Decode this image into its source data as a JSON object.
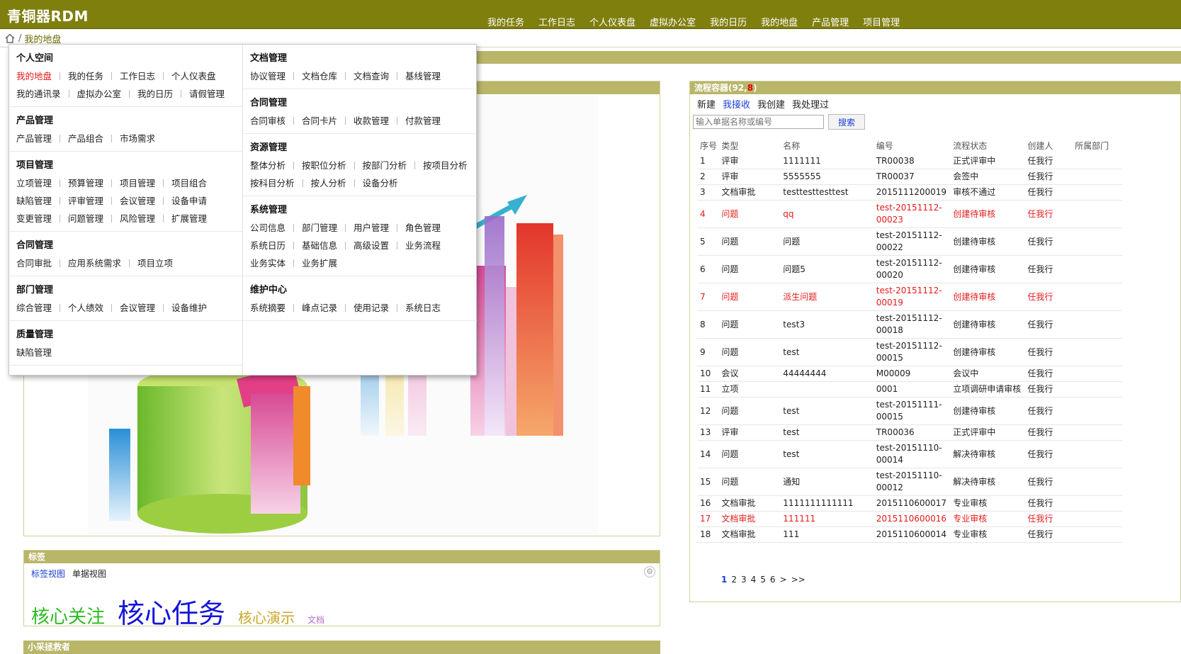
{
  "app": {
    "title": "青铜器RDM"
  },
  "topnav": [
    "我的任务",
    "工作日志",
    "个人仪表盘",
    "虚拟办公室",
    "我的日历",
    "我的地盘",
    "产品管理",
    "项目管理"
  ],
  "breadcrumb": {
    "sep": "/",
    "current": "我的地盘"
  },
  "menu": {
    "left": [
      {
        "title": "个人空间",
        "rows": [
          [
            "我的地盘",
            "我的任务",
            "工作日志",
            "个人仪表盘"
          ],
          [
            "我的通讯录",
            "虚拟办公室",
            "我的日历",
            "请假管理"
          ]
        ],
        "active": "我的地盘"
      },
      {
        "title": "产品管理",
        "rows": [
          [
            "产品管理",
            "产品组合",
            "市场需求"
          ]
        ]
      },
      {
        "title": "项目管理",
        "rows": [
          [
            "立项管理",
            "预算管理",
            "项目管理",
            "项目组合"
          ],
          [
            "缺陷管理",
            "评审管理",
            "会议管理",
            "设备申请"
          ],
          [
            "变更管理",
            "问题管理",
            "风险管理",
            "扩展管理"
          ]
        ]
      },
      {
        "title": "合同管理",
        "rows": [
          [
            "合同审批",
            "应用系统需求",
            "项目立项"
          ]
        ]
      },
      {
        "title": "部门管理",
        "rows": [
          [
            "综合管理",
            "个人绩效",
            "会议管理",
            "设备维护"
          ]
        ]
      },
      {
        "title": "质量管理",
        "rows": [
          [
            "缺陷管理"
          ]
        ]
      }
    ],
    "right": [
      {
        "title": "文档管理",
        "rows": [
          [
            "协议管理",
            "文档仓库",
            "文档查询",
            "基线管理"
          ]
        ]
      },
      {
        "title": "合同管理",
        "rows": [
          [
            "合同审核",
            "合同卡片",
            "收款管理",
            "付款管理"
          ]
        ]
      },
      {
        "title": "资源管理",
        "rows": [
          [
            "整体分析",
            "按职位分析",
            "按部门分析",
            "按项目分析"
          ],
          [
            "按科目分析",
            "按人分析",
            "设备分析"
          ]
        ]
      },
      {
        "title": "系统管理",
        "rows": [
          [
            "公司信息",
            "部门管理",
            "用户管理",
            "角色管理"
          ],
          [
            "系统日历",
            "基础信息",
            "高级设置",
            "业务流程"
          ],
          [
            "业务实体",
            "业务扩展"
          ]
        ]
      },
      {
        "title": "维护中心",
        "rows": [
          [
            "系统摘要",
            "峰点记录",
            "使用记录",
            "系统日志"
          ]
        ]
      }
    ]
  },
  "tags": {
    "header": "标签",
    "tabs": [
      "标签视图",
      "单据视图"
    ],
    "cloud": [
      {
        "text": "核心关注",
        "color": "#2dbb22",
        "size": "26px"
      },
      {
        "text": "核心任务",
        "color": "#1515d8",
        "size": "38px"
      },
      {
        "text": "核心演示",
        "color": "#c9a62a",
        "size": "20px"
      },
      {
        "text": "文档",
        "color": "#b36cc6",
        "size": "12px"
      }
    ]
  },
  "bottom": {
    "header": "小采拯救者"
  },
  "flow": {
    "title": "流程容器",
    "count_a": "92",
    "count_b": "8",
    "tabs": [
      "新建",
      "我接收",
      "我创建",
      "我处理过"
    ],
    "search_placeholder": "输入单据名称或编号",
    "search_button": "搜索",
    "columns": [
      "序号",
      "类型",
      "名称",
      "编号",
      "流程状态",
      "创建人",
      "所属部门"
    ],
    "rows": [
      {
        "no": "1",
        "type": "评审",
        "name": "1111111",
        "code": "TR00038",
        "status": "正式评审中",
        "creator": "任我行",
        "red": false
      },
      {
        "no": "2",
        "type": "评审",
        "name": "5555555",
        "code": "TR00037",
        "status": "会签中",
        "creator": "任我行",
        "red": false
      },
      {
        "no": "3",
        "type": "文档审批",
        "name": "testtesttesttest",
        "code": "2015111200019",
        "status": "审核不通过",
        "creator": "任我行",
        "red": false
      },
      {
        "no": "4",
        "type": "问题",
        "name": "qq",
        "code": "test-20151112-00023",
        "status": "创建待审核",
        "creator": "任我行",
        "red": true
      },
      {
        "no": "5",
        "type": "问题",
        "name": "问题",
        "code": "test-20151112-00022",
        "status": "创建待审核",
        "creator": "任我行",
        "red": false
      },
      {
        "no": "6",
        "type": "问题",
        "name": "问题5",
        "code": "test-20151112-00020",
        "status": "创建待审核",
        "creator": "任我行",
        "red": false
      },
      {
        "no": "7",
        "type": "问题",
        "name": "派生问题",
        "code": "test-20151112-00019",
        "status": "创建待审核",
        "creator": "任我行",
        "red": true
      },
      {
        "no": "8",
        "type": "问题",
        "name": "test3",
        "code": "test-20151112-00018",
        "status": "创建待审核",
        "creator": "任我行",
        "red": false
      },
      {
        "no": "9",
        "type": "问题",
        "name": "test",
        "code": "test-20151112-00015",
        "status": "创建待审核",
        "creator": "任我行",
        "red": false
      },
      {
        "no": "10",
        "type": "会议",
        "name": "44444444",
        "code": "M00009",
        "status": "会议中",
        "creator": "任我行",
        "red": false
      },
      {
        "no": "11",
        "type": "立项",
        "name": "",
        "code": "0001",
        "status": "立项调研申请审核",
        "creator": "任我行",
        "red": false
      },
      {
        "no": "12",
        "type": "问题",
        "name": "test",
        "code": "test-20151111-00015",
        "status": "创建待审核",
        "creator": "任我行",
        "red": false
      },
      {
        "no": "13",
        "type": "评审",
        "name": "test",
        "code": "TR00036",
        "status": "正式评审中",
        "creator": "任我行",
        "red": false
      },
      {
        "no": "14",
        "type": "问题",
        "name": "test",
        "code": "test-20151110-00014",
        "status": "解决待审核",
        "creator": "任我行",
        "red": false
      },
      {
        "no": "15",
        "type": "问题",
        "name": "通知",
        "code": "test-20151110-00012",
        "status": "解决待审核",
        "creator": "任我行",
        "red": false
      },
      {
        "no": "16",
        "type": "文档审批",
        "name": "1111111111111",
        "code": "2015110600017",
        "status": "专业审核",
        "creator": "任我行",
        "red": false
      },
      {
        "no": "17",
        "type": "文档审批",
        "name": "111111",
        "code": "2015110600016",
        "status": "专业审核",
        "creator": "任我行",
        "red": true
      },
      {
        "no": "18",
        "type": "文档审批",
        "name": "111",
        "code": "2015110600014",
        "status": "专业审核",
        "creator": "任我行",
        "red": false
      }
    ],
    "pager": {
      "current": "1",
      "pages": [
        "2",
        "3",
        "4",
        "5",
        "6"
      ],
      "next": ">",
      "last": ">>"
    }
  }
}
